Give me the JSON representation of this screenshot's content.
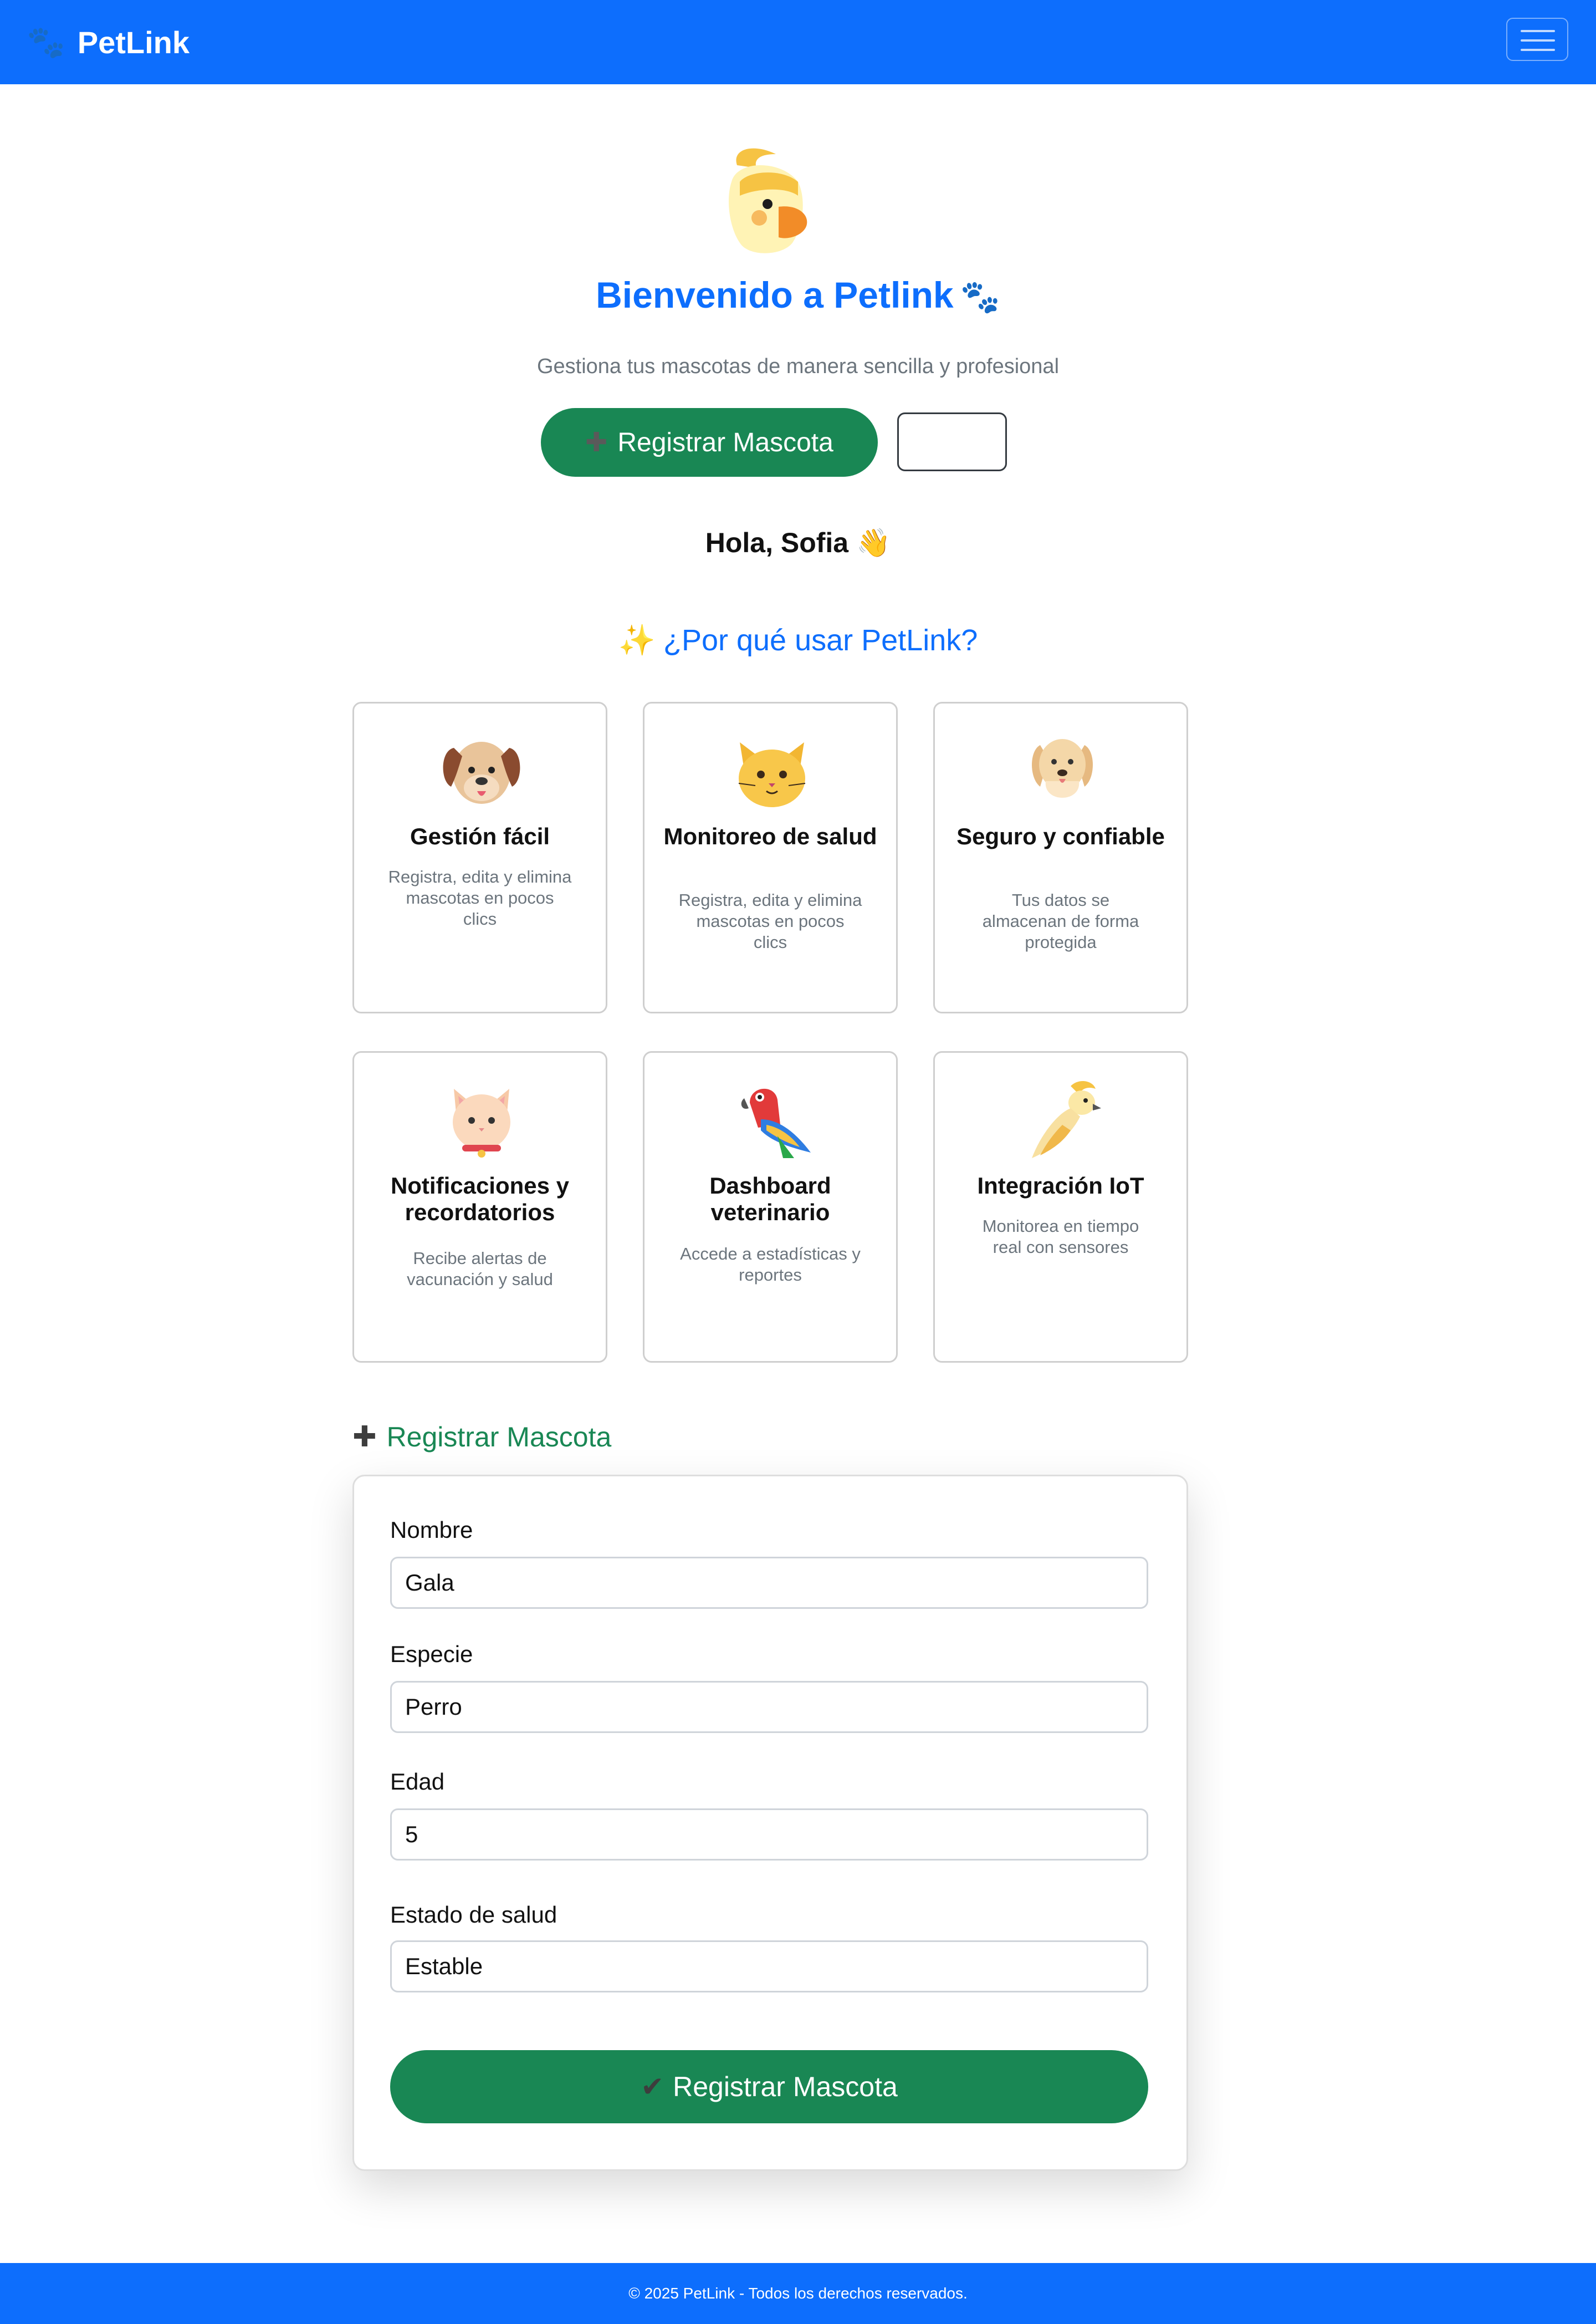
{
  "navbar": {
    "brand_icon": "paw-icon",
    "brand_name": "PetLink",
    "toggler_icon": "hamburger-icon",
    "bg_color": "#0d6efd"
  },
  "hero": {
    "icon": "cockatiel-icon",
    "title": "Bienvenido a Petlink",
    "title_icon": "paw-icon",
    "subtitle": "Gestiona tus mascotas de manera sencilla y profesional",
    "register_button": "Registrar Mascota",
    "register_button_icon": "plus-icon",
    "greeting": "Hola, Sofia",
    "greeting_icon": "waving-hand-icon"
  },
  "features": {
    "title": "¿Por qué usar PetLink?",
    "title_icon": "sparkles-icon",
    "cards": [
      {
        "icon": "dog-face-icon",
        "title": "Gestión fácil",
        "desc": "Registra, edita y elimina mascotas en pocos clics"
      },
      {
        "icon": "cat-face-icon",
        "title": "Monitoreo de salud",
        "desc": "Registra, edita y elimina mascotas en pocos clics"
      },
      {
        "icon": "golden-retriever-icon",
        "title": "Seguro y confiable",
        "desc": "Tus datos se almacenan de forma protegida"
      },
      {
        "icon": "cat-with-collar-icon",
        "title": "Notificaciones y recordatorios",
        "desc": "Recibe alertas de vacunación y salud"
      },
      {
        "icon": "parrot-icon",
        "title": "Dashboard veterinario",
        "desc": "Accede a estadísticas y reportes"
      },
      {
        "icon": "cockatoo-icon",
        "title": "Integración IoT",
        "desc": "Monitorea en tiempo real con sensores"
      }
    ]
  },
  "form": {
    "heading": "Registrar Mascota",
    "heading_icon": "plus-icon",
    "fields": [
      {
        "label": "Nombre",
        "value": "Gala"
      },
      {
        "label": "Especie",
        "value": "Perro"
      },
      {
        "label": "Edad",
        "value": "5"
      },
      {
        "label": "Estado de salud",
        "value": "Estable"
      }
    ],
    "submit": "Registrar Mascota",
    "submit_icon": "check-icon"
  },
  "footer": {
    "text": "© 2025 PetLink - Todos los derechos reservados."
  },
  "colors": {
    "primary": "#0d6efd",
    "success": "#198754",
    "muted": "#6c757d"
  }
}
